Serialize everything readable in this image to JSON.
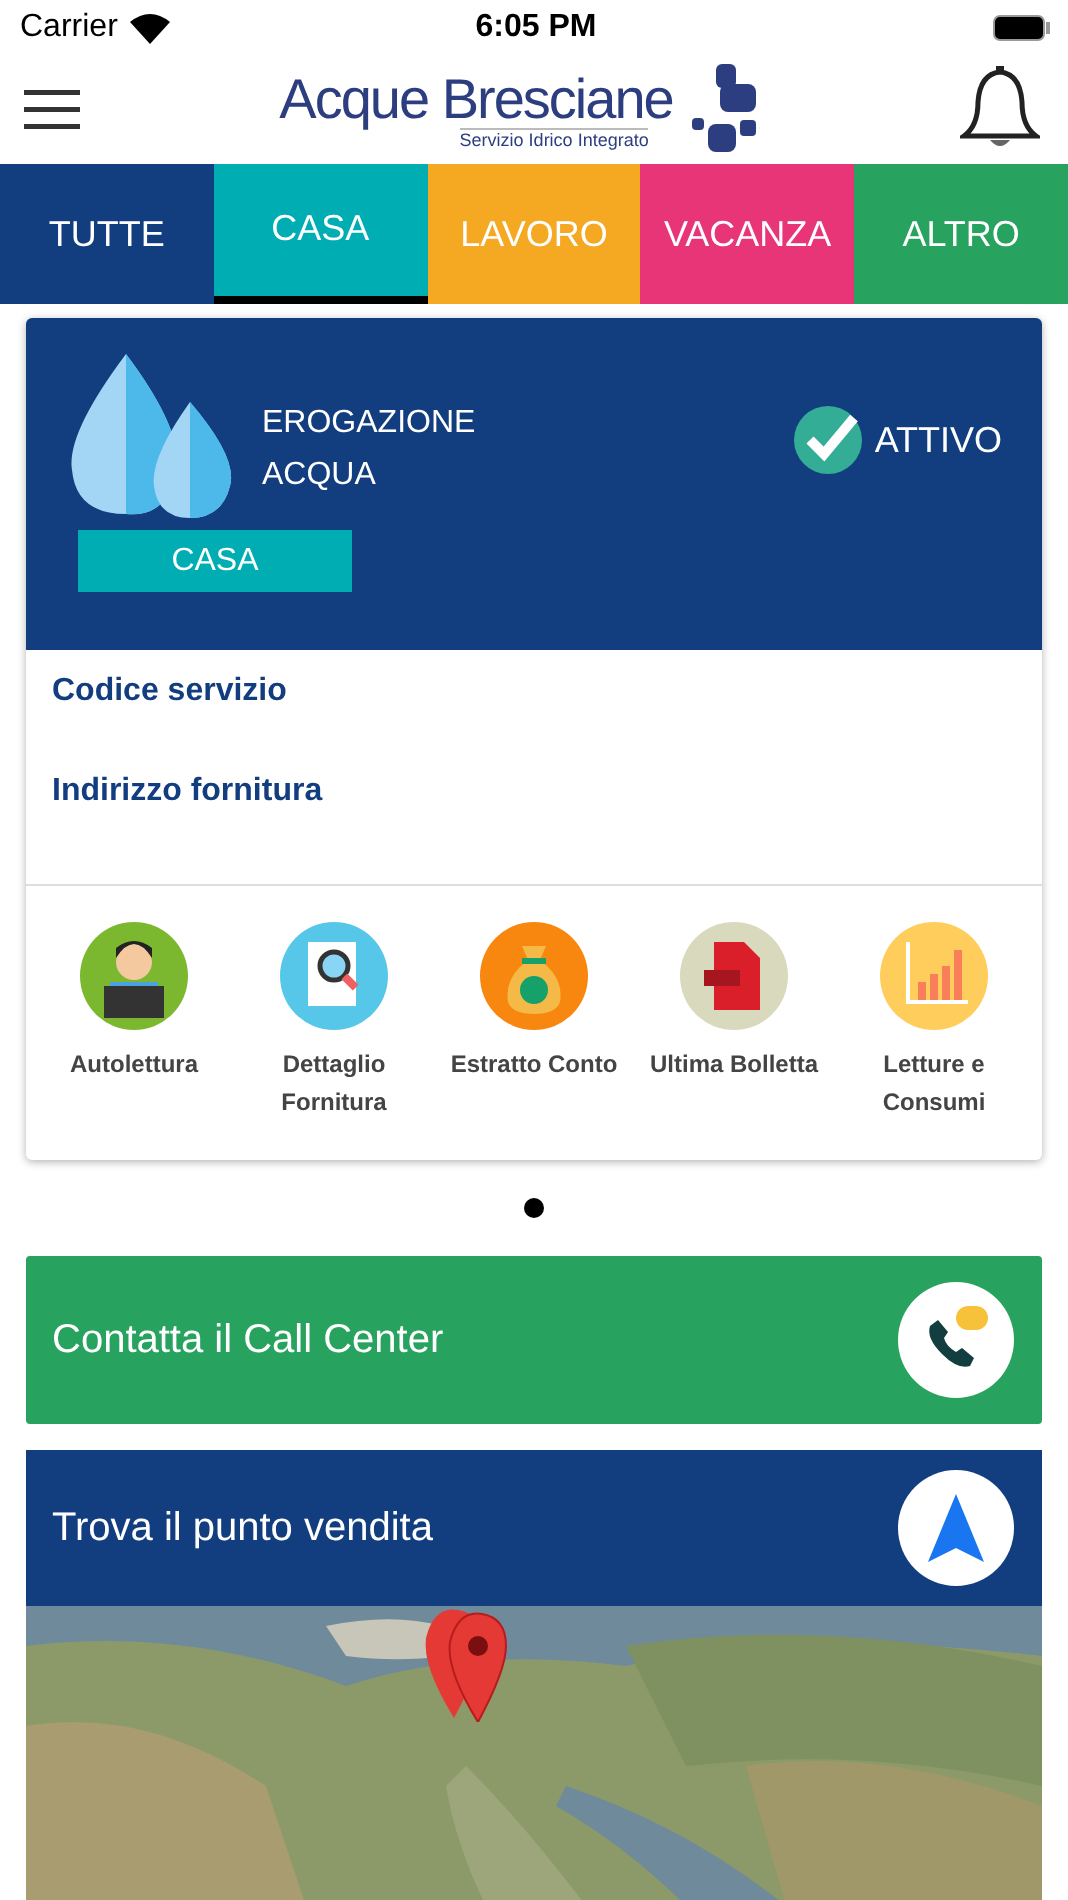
{
  "status_bar": {
    "carrier": "Carrier",
    "time": "6:05 PM"
  },
  "header": {
    "logo_title": "Acque Bresciane",
    "logo_subtitle": "Servizio Idrico Integrato"
  },
  "tabs": [
    {
      "label": "TUTTE",
      "color": "#123e80",
      "selected": false
    },
    {
      "label": "CASA",
      "color": "#00adb3",
      "selected": true
    },
    {
      "label": "LAVORO",
      "color": "#f5a822",
      "selected": false
    },
    {
      "label": "VACANZA",
      "color": "#e73577",
      "selected": false
    },
    {
      "label": "ALTRO",
      "color": "#27a35f",
      "selected": false
    }
  ],
  "service_card": {
    "title_lines": [
      "EROGAZIONE",
      "ACQUA"
    ],
    "status": "ATTIVO",
    "active": true,
    "category": "CASA",
    "fields": [
      {
        "label": "Codice servizio"
      },
      {
        "label": "Indirizzo fornitura"
      }
    ],
    "actions": [
      {
        "kind": "reading",
        "label_lines": [
          "Autolettura"
        ]
      },
      {
        "kind": "detail",
        "label_lines": [
          "Dettaglio",
          "Fornitura"
        ]
      },
      {
        "kind": "money",
        "label_lines": [
          "Estratto Conto"
        ]
      },
      {
        "kind": "pdf",
        "label_lines": [
          "Ultima Bolletta"
        ]
      },
      {
        "kind": "chart",
        "label_lines": [
          "Letture e",
          "Consumi"
        ]
      }
    ]
  },
  "pager": {
    "pages": [
      {
        "selected": true
      }
    ]
  },
  "call_center": {
    "label": "Contatta il Call Center"
  },
  "store_finder": {
    "label": "Trova il punto vendita"
  }
}
